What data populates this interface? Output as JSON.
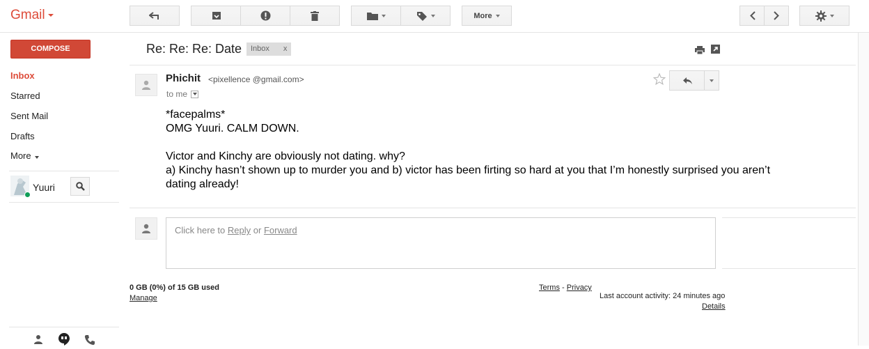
{
  "app": {
    "logo": "Gmail"
  },
  "toolbar": {
    "more_label": "More",
    "icons": [
      "back-arrow-icon",
      "archive-icon",
      "report-spam-icon",
      "delete-icon",
      "move-to-folder-icon",
      "labels-icon",
      "prev-icon",
      "next-icon",
      "settings-gear-icon"
    ]
  },
  "sidebar": {
    "compose_label": "COMPOSE",
    "items": [
      {
        "label": "Inbox",
        "active": true
      },
      {
        "label": "Starred"
      },
      {
        "label": "Sent Mail"
      },
      {
        "label": "Drafts"
      },
      {
        "label": "More"
      }
    ],
    "chat_user": "Yuuri"
  },
  "message": {
    "subject": "Re: Re: Re: Date",
    "label": "Inbox",
    "label_remove": "x",
    "sender_name": "Phichit",
    "sender_email": "<pixellence @gmail.com>",
    "to": "to me",
    "body_lines": [
      "*facepalms*",
      "OMG Yuuri. CALM DOWN.",
      "",
      "Victor and Kinchy are obviously not dating. why?",
      "a) Kinchy hasn’t shown up to murder you and b) victor has been firting so hard at you that I’m honestly surprised you aren’t",
      "dating already!"
    ]
  },
  "reply": {
    "prefix": "Click here to",
    "reply_link": "Reply",
    "or": "or",
    "forward_link": "Forward"
  },
  "footer": {
    "storage": "0 GB (0%) of 15 GB used",
    "manage": "Manage",
    "terms": "Terms",
    "dash": "-",
    "privacy": "Privacy",
    "activity": "Last account activity: 24 minutes ago",
    "details": "Details"
  },
  "colors": {
    "accent": "#dd4b39",
    "compose": "#d14836",
    "presence": "#0f9d58"
  }
}
